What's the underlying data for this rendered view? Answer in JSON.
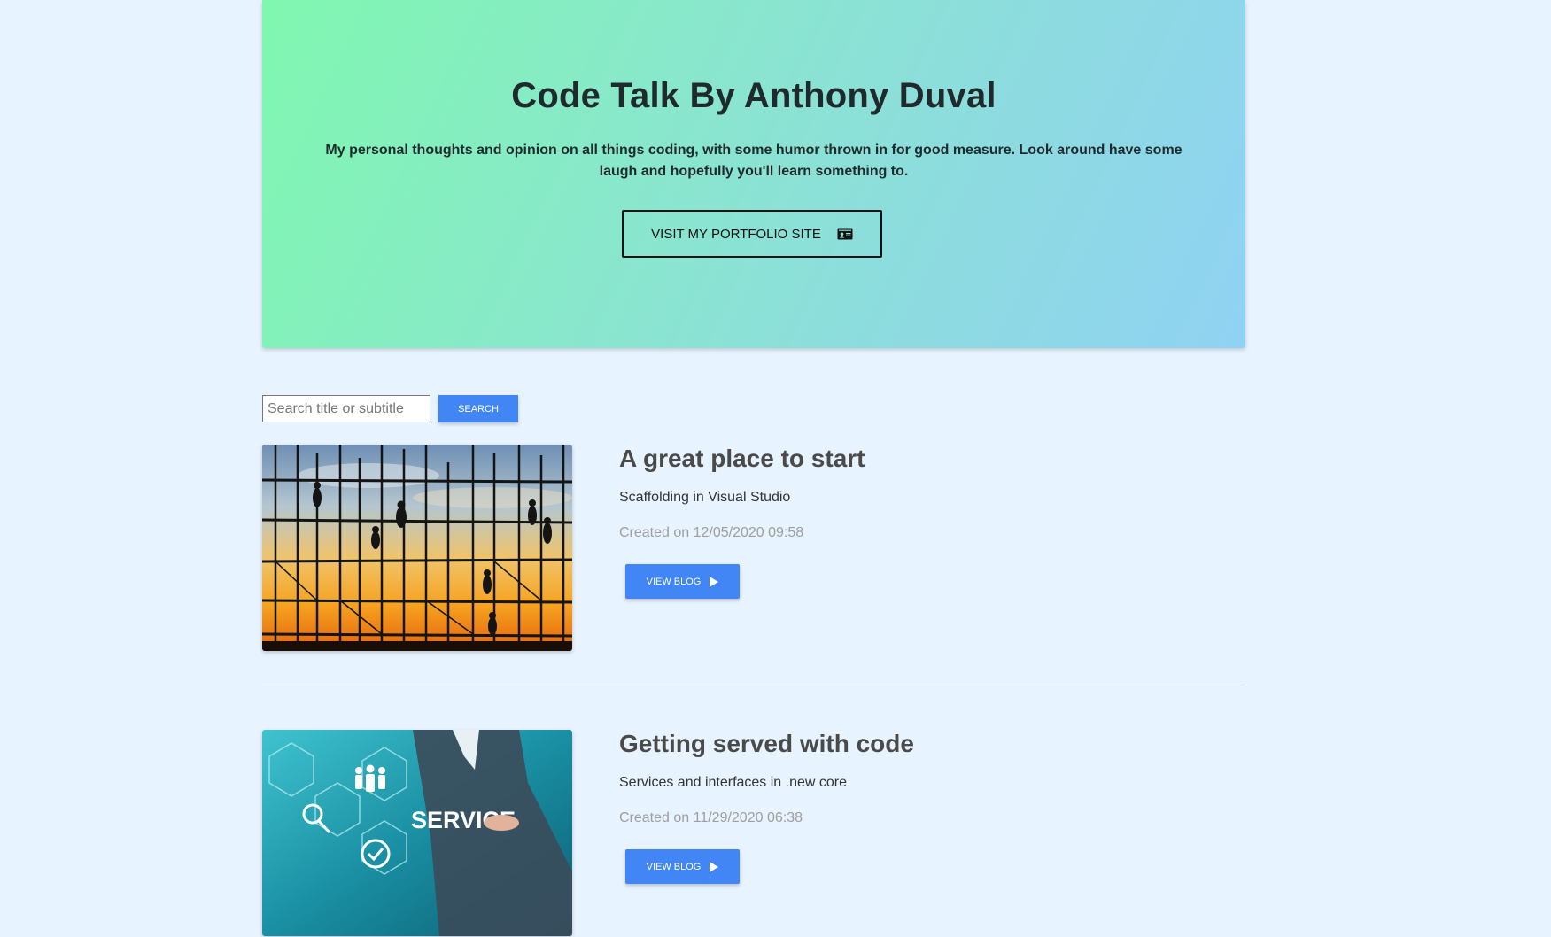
{
  "hero": {
    "title": "Code Talk By Anthony Duval",
    "description": "My personal thoughts and opinion on all things coding, with some humor thrown in for good measure. Look around have some laugh and hopefully you'll learn something to.",
    "portfolio_button": "VISIT MY PORTFOLIO SITE",
    "portfolio_icon": "id-card-icon"
  },
  "search": {
    "placeholder": "Search title or subtitle",
    "value": "",
    "button_label": "SEARCH"
  },
  "blogs": [
    {
      "title": "A great place to start",
      "subtitle": "Scaffolding in Visual Studio",
      "date": "Created on 12/05/2020 09:58",
      "button_label": "VIEW BLOG",
      "image": "scaffolding-sunset-photo"
    },
    {
      "title": "Getting served with code",
      "subtitle": "Services and interfaces in .new core",
      "date": "Created on 11/29/2020 06:38",
      "button_label": "VIEW BLOG",
      "image": "service-businessman-photo",
      "image_text": "SERVICE"
    }
  ],
  "colors": {
    "page_bg": "#e7f3fe",
    "accent_blue": "#4285f4",
    "hero_gradient_start": "#80f7b0",
    "hero_gradient_end": "#90d2f3"
  }
}
